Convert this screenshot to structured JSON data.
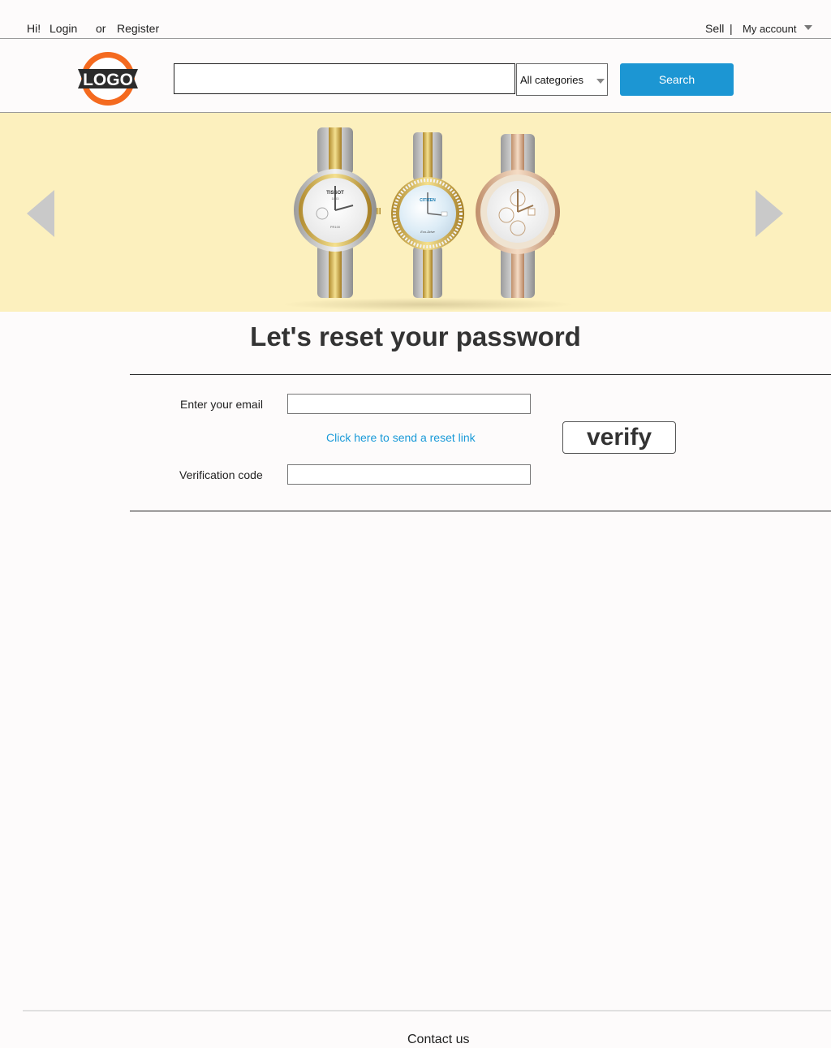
{
  "topbar": {
    "greeting": "Hi!",
    "login": "Login",
    "or": "or",
    "register": "Register",
    "sell": "Sell",
    "separator": "|",
    "my_account": "My account"
  },
  "header": {
    "logo_text": "LOGO",
    "search": {
      "value": "",
      "placeholder": ""
    },
    "category": "All categories",
    "search_button": "Search"
  },
  "banner": {
    "watches": [
      {
        "brand": "TISSOT",
        "sub": "1853",
        "mark": "PR100"
      },
      {
        "brand": "CITIZEN",
        "mark": "Eco-Drive"
      },
      {
        "brand": "",
        "mark": ""
      }
    ]
  },
  "reset": {
    "title": "Let's reset your password",
    "email_label": "Enter your email",
    "email_value": "",
    "send_link": "Click here to send a reset link",
    "code_label": "Verification code",
    "code_value": "",
    "verify_button": "verify"
  },
  "footer": {
    "contact": "Contact us"
  },
  "colors": {
    "accent": "#1c96d3",
    "link": "#1a9ad8",
    "banner_bg": "#fcf0be",
    "logo_orange": "#f46a1f"
  }
}
